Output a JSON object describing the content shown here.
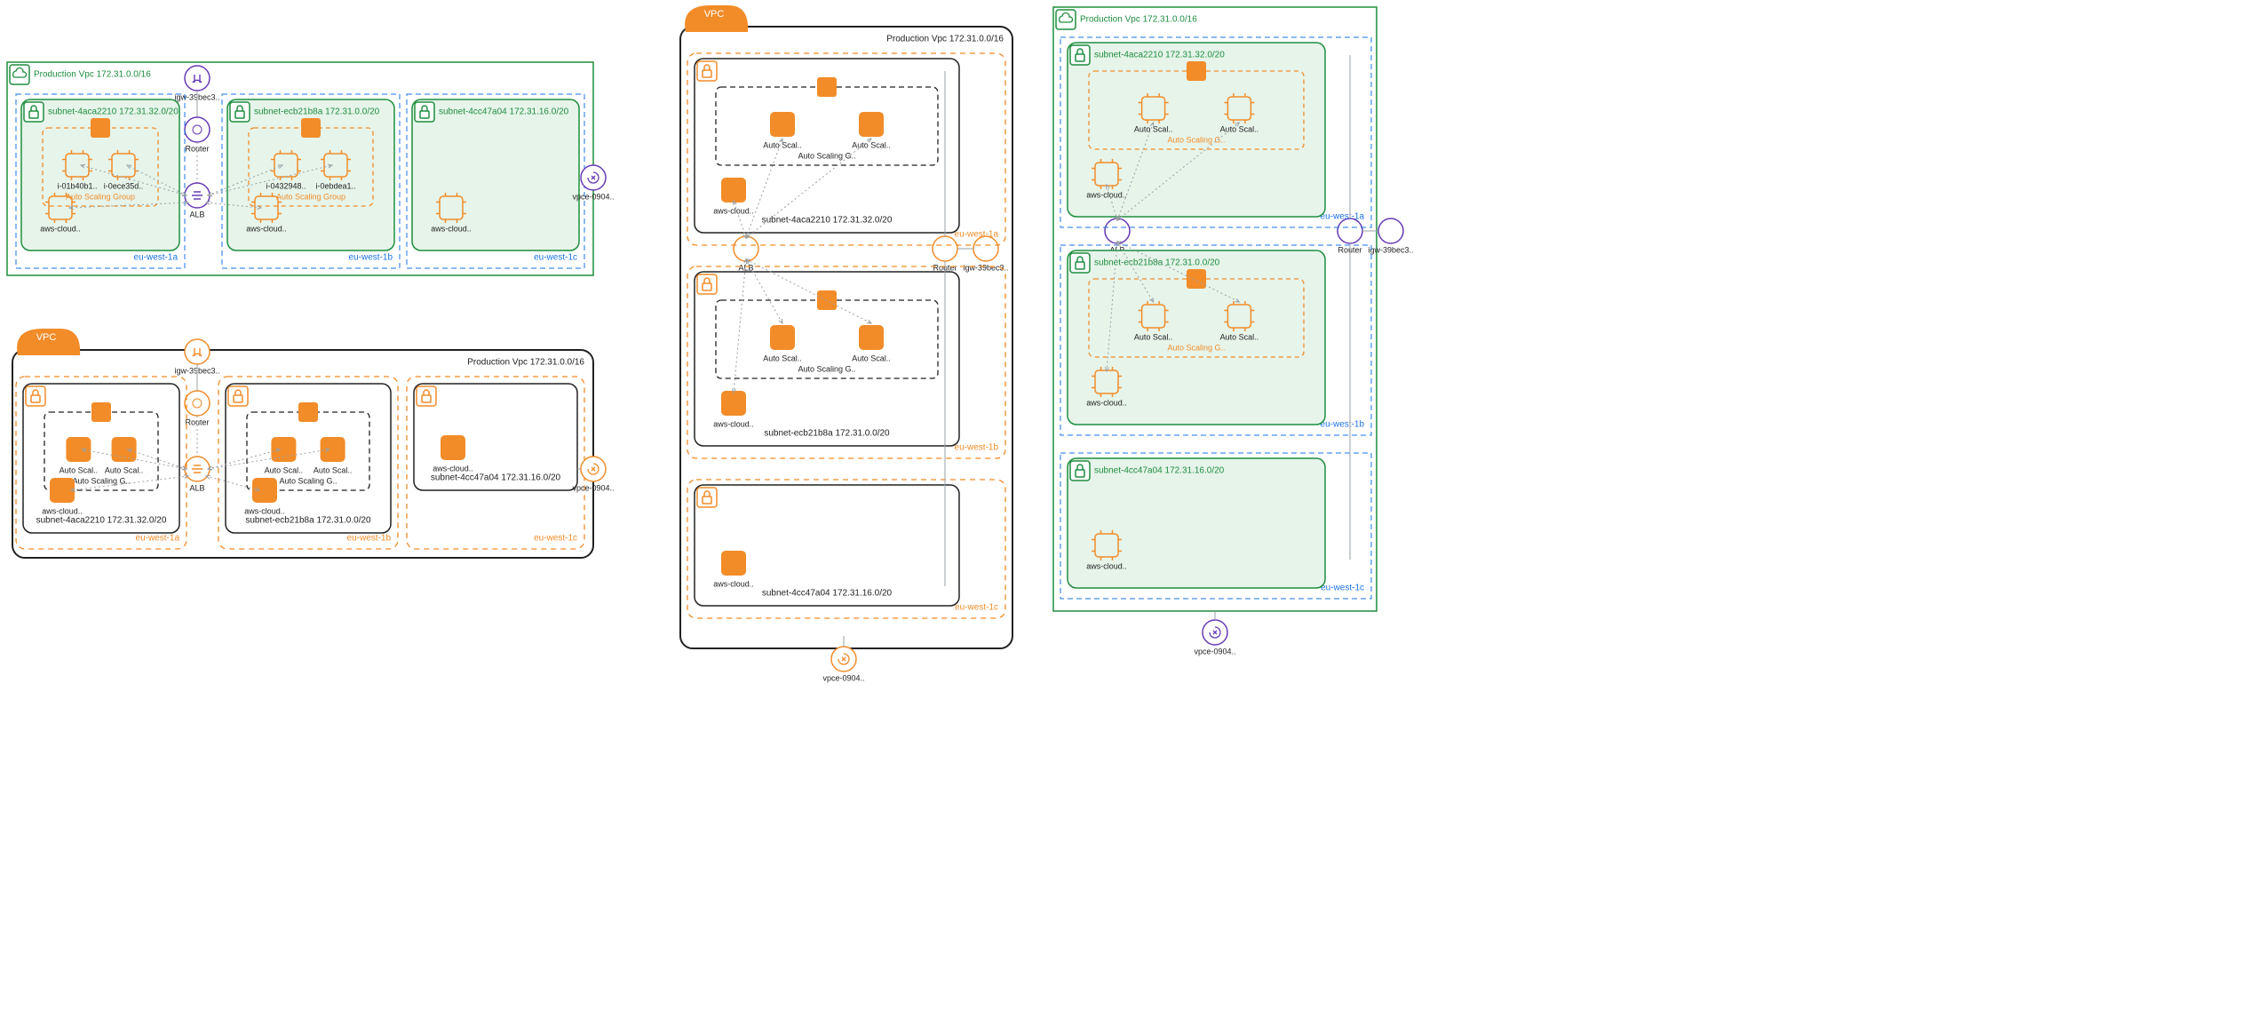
{
  "colors": {
    "green": "#1e8e3e",
    "greenFill": "#e6f4ea",
    "blue": "#1a73e8",
    "orange": "#f28c28",
    "orangeFill": "#f28c28",
    "purple": "#673ab7",
    "gray": "#9aa0a6",
    "black": "#222"
  },
  "vpc": {
    "title": "Production Vpc 172.31.0.0/16",
    "badge": "VPC"
  },
  "az": {
    "a": "eu-west-1a",
    "b": "eu-west-1b",
    "c": "eu-west-1c"
  },
  "subnets": {
    "a": {
      "title": "subnet-4aca2210 172.31.32.0/20"
    },
    "b": {
      "title": "subnet-ecb21b8a 172.31.0.0/20"
    },
    "c": {
      "title": "subnet-4cc47a04 172.31.16.0/20"
    }
  },
  "asg": {
    "label": "Auto Scaling Group",
    "labelShort": "Auto Scaling G..",
    "nodeLabel": "Auto Scal.."
  },
  "instances": {
    "a1": "i-01b40b1..",
    "a2": "i-0ece35d..",
    "b1": "i-0432948..",
    "b2": "i-0ebdea1.."
  },
  "cloud": {
    "label": "aws-cloud.."
  },
  "net": {
    "igw": "igw-39bec3..",
    "router": "Router",
    "alb": "ALB",
    "vpce": "vpce-0904.."
  }
}
